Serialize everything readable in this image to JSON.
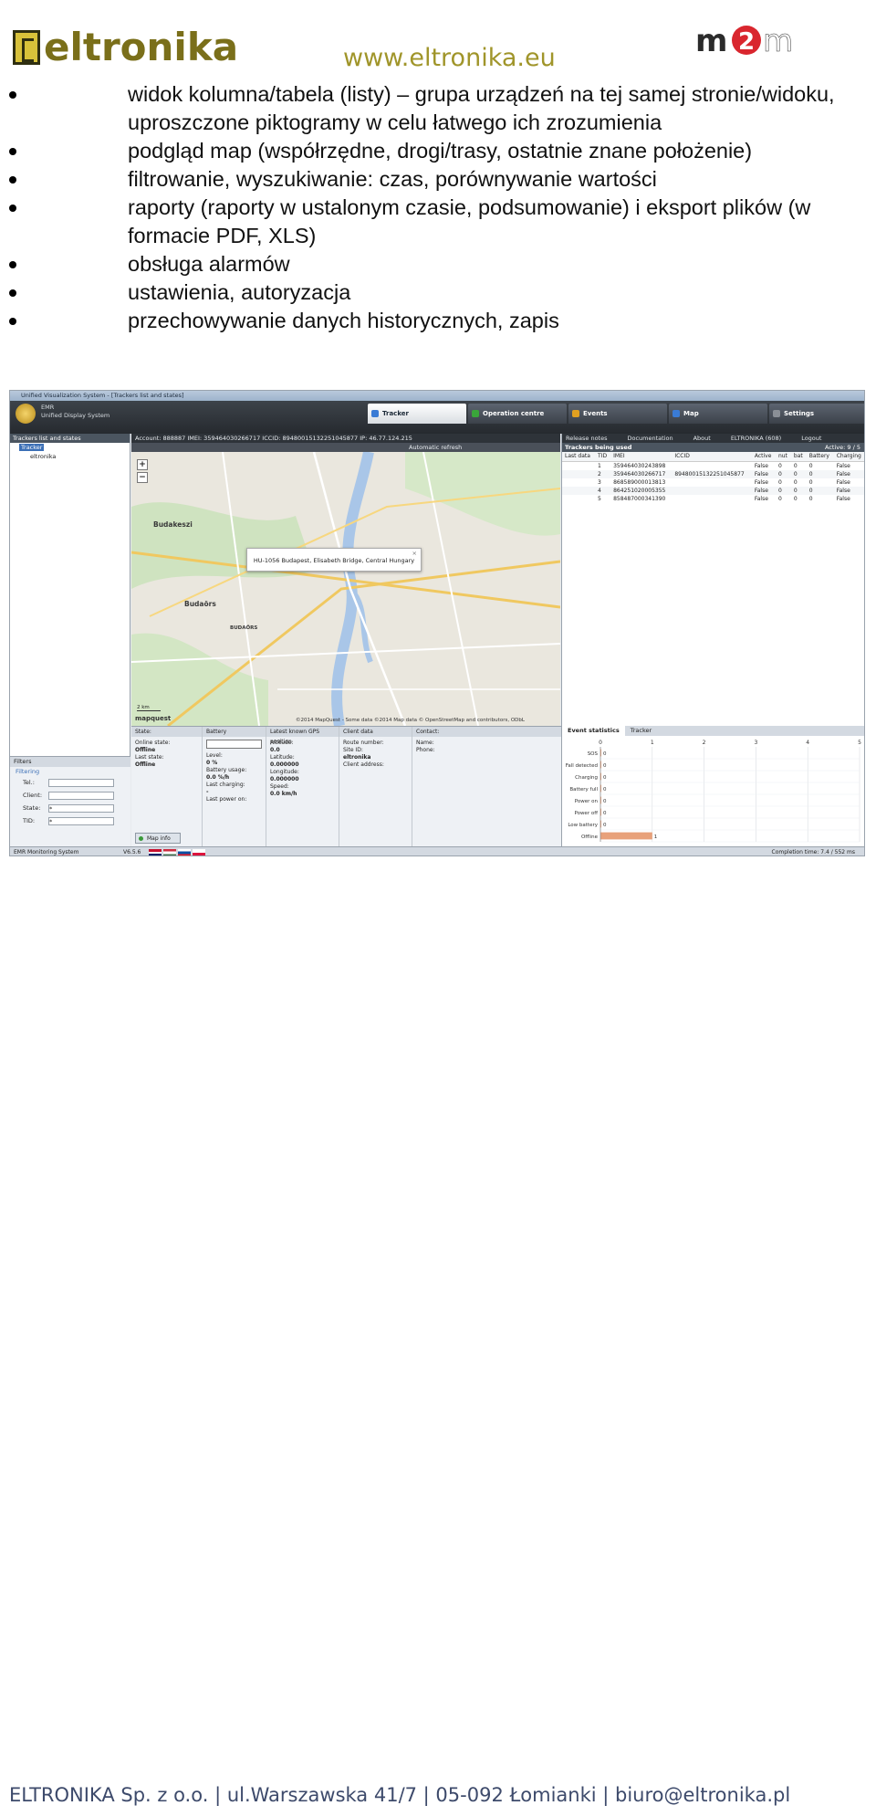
{
  "header": {
    "logo_text": "eltronika",
    "site_url": "www.eltronika.eu",
    "partner_logo_text": "m2m"
  },
  "bullets": [
    "widok kolumna/tabela (listy) – grupa urządzeń na tej samej stronie/widoku, uproszczone piktogramy w celu łatwego ich zrozumienia",
    "podgląd map (współrzędne, drogi/trasy, ostatnie znane położenie)",
    "filtrowanie, wyszukiwanie: czas, porównywanie wartości",
    "raporty (raporty w ustalonym czasie, podsumowanie) i eksport plików (w formacie PDF, XLS)",
    "obsługa alarmów",
    "ustawienia, autoryzacja",
    "przechowywanie danych historycznych, zapis"
  ],
  "screenshot": {
    "window_title": "Unified Visualization System - [Trackers list and states]",
    "app_name_line1": "EMR",
    "app_name_line2": "Unified Display System",
    "nav_tabs": [
      {
        "label": "Tracker",
        "color": "#3a7bd5"
      },
      {
        "label": "Operation centre",
        "color": "#3aa63a"
      },
      {
        "label": "Events",
        "color": "#e0a020"
      },
      {
        "label": "Map",
        "color": "#3a7bd5"
      },
      {
        "label": "Settings",
        "color": "#8a8f96"
      }
    ],
    "left_pane": {
      "header": "Trackers list and states",
      "tree": [
        "Tracker",
        "eltronika"
      ]
    },
    "filters": {
      "header": "Filters",
      "sub_header": "Filtering",
      "fields": [
        {
          "label": "Tel.:",
          "value": ""
        },
        {
          "label": "Client:",
          "value": ""
        },
        {
          "label": "State:",
          "value": "*"
        },
        {
          "label": "TID:",
          "value": "*"
        }
      ]
    },
    "map": {
      "bar_text": "Account: 888887  IMEI: 359464030266717  ICCID: 89480015132251045877  IP: 46.77.124.215",
      "auto_refresh": "Automatic refresh",
      "popup": "HU-1056 Budapest, Elisabeth Bridge, Central Hungary",
      "labels": [
        "Budakeszi",
        "Budaörs",
        "BUDAÖRS"
      ],
      "scale": "2 km",
      "provider": "mapquest",
      "attribution": "©2014 MapQuest - Some data ©2014 Map data © OpenStreetMap and contributors, ODbL"
    },
    "right_top_links": [
      "Release notes",
      "Documentation",
      "About",
      "ELTRONIKA (608)",
      "Logout"
    ],
    "trackers": {
      "header": "Trackers being used",
      "active": "Active: 9 / 5",
      "columns": [
        "Last data",
        "TID",
        "IMEI",
        "ICCID",
        "Active",
        "nut",
        "bat",
        "Battery",
        "Charging"
      ],
      "rows": [
        [
          "",
          "1",
          "359464030243898",
          "",
          "False",
          "0",
          "0",
          "0",
          "False"
        ],
        [
          "",
          "2",
          "359464030266717",
          "89480015132251045877",
          "False",
          "0",
          "0",
          "0",
          "False"
        ],
        [
          "",
          "3",
          "868589000013813",
          "",
          "False",
          "0",
          "0",
          "0",
          "False"
        ],
        [
          "",
          "4",
          "864251020005355",
          "",
          "False",
          "0",
          "0",
          "0",
          "False"
        ],
        [
          "",
          "5",
          "858487000341390",
          "",
          "False",
          "0",
          "0",
          "0",
          "False"
        ]
      ]
    },
    "details": {
      "state": {
        "title": "State:",
        "lines": [
          [
            "Online state:",
            "Offline"
          ],
          [
            "Last state:",
            "Offline"
          ]
        ]
      },
      "battery": {
        "title": "Battery",
        "lines": [
          [
            "Level:",
            "0 %"
          ],
          [
            "Battery usage:",
            "0.0 %/h"
          ],
          [
            "Last charging:",
            "-"
          ],
          [
            "Last power on:",
            ""
          ]
        ]
      },
      "gps": {
        "title": "Latest known GPS position",
        "lines": [
          [
            "Altitude:",
            "0.0"
          ],
          [
            "Latitude:",
            "0.000000"
          ],
          [
            "Longitude:",
            "0.000000"
          ],
          [
            "Speed:",
            "0.0 km/h"
          ]
        ]
      },
      "client": {
        "title": "Client data",
        "lines": [
          [
            "Route number:",
            ""
          ],
          [
            "Site ID:",
            "eltronika"
          ],
          [
            "Client address:",
            ""
          ]
        ]
      },
      "contact": {
        "title": "Contact:",
        "lines": [
          [
            "Name:",
            ""
          ],
          [
            "Phone:",
            ""
          ]
        ]
      },
      "map_info_button": "Map info"
    },
    "event_stats": {
      "tabs": [
        "Event statistics",
        "Tracker"
      ],
      "chart_data": {
        "type": "bar",
        "orientation": "horizontal",
        "categories": [
          "SOS",
          "Fall detected",
          "Charging",
          "Battery full",
          "Power on",
          "Power off",
          "Low battery",
          "Offline"
        ],
        "values": [
          0,
          0,
          0,
          0,
          0,
          0,
          0,
          1
        ],
        "xlim": [
          0,
          5
        ],
        "xticks": [
          "0",
          "1",
          "2",
          "3",
          "4",
          "5"
        ],
        "bar_color": "#e8a17a"
      }
    },
    "statusbar": {
      "left": "EMR Monitoring System",
      "version": "V6.5.6",
      "completion": "Completion time: 7.4 / 552 ms"
    }
  },
  "footer": "ELTRONIKA Sp. z o.o. | ul.Warszawska 41/7 | 05-092 Łomianki | biuro@eltronika.pl"
}
